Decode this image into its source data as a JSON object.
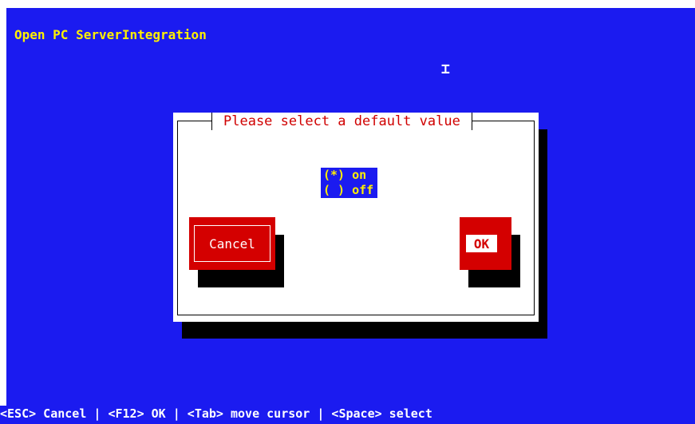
{
  "app": {
    "title": "Open PC ServerIntegration"
  },
  "dialog": {
    "title": "Please select a default value",
    "options": [
      {
        "marker": "(*)",
        "label": "on",
        "selected": true
      },
      {
        "marker": "( )",
        "label": "off",
        "selected": false
      }
    ],
    "buttons": {
      "cancel_label": "Cancel",
      "ok_label": "OK"
    }
  },
  "status_bar": {
    "text": "<ESC> Cancel | <F12> OK | <Tab> move cursor | <Space> select"
  },
  "colors": {
    "background": "#1b1bf0",
    "title_text": "#fff000",
    "dialog_title_text": "#d00000",
    "button_red": "#d40000"
  }
}
